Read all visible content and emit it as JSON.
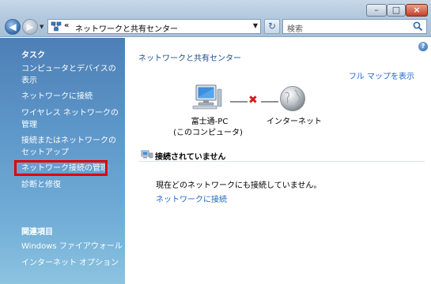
{
  "window": {
    "minimize_glyph": "–",
    "maximize_glyph": "□",
    "close_glyph": "×"
  },
  "toolbar": {
    "back_glyph": "◀",
    "forward_glyph": "▶",
    "refresh_glyph": "↻",
    "address": {
      "chevron": "«",
      "text": "ネットワークと共有センター",
      "dropdown_glyph": "▼"
    },
    "search": {
      "placeholder": "検索"
    }
  },
  "sidebar": {
    "tasks_heading": "タスク",
    "tasks": [
      {
        "label": "コンピュータとデバイスの表示"
      },
      {
        "label": "ネットワークに接続"
      },
      {
        "label": "ワイヤレス ネットワークの管理"
      },
      {
        "label": "接続またはネットワークのセットアップ"
      },
      {
        "label": "ネットワーク接続の管理"
      },
      {
        "label": "診断と修復"
      }
    ],
    "related_heading": "関連項目",
    "related": [
      {
        "label": "Windows ファイアウォール"
      },
      {
        "label": "インターネット オプション"
      }
    ]
  },
  "main": {
    "help_glyph": "?",
    "title": "ネットワークと共有センター",
    "full_map_link": "フル マップを表示",
    "map": {
      "computer_name": "富士通-PC",
      "computer_sub": "(このコンピュータ)",
      "internet_label": "インターネット",
      "disconnect_glyph": "✖"
    },
    "status_heading": "接続されていません",
    "status_message": "現在どのネットワークにも接続していません。",
    "connect_link": "ネットワークに接続"
  },
  "colors": {
    "link": "#1f66c9",
    "highlight_box": "#e00000",
    "disconnect": "#d41a1a"
  }
}
